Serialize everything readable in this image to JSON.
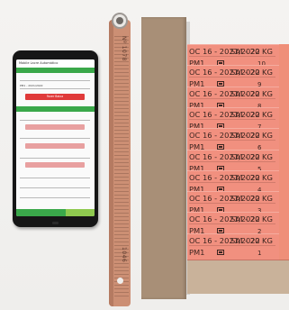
{
  "phone_screen": {
    "app_title": "Mobile Lacre Automático",
    "field_1_value": "PM1 - 2021/2022",
    "button_red": "Fazer Baixa"
  },
  "tags": [
    {
      "line1": "OC 16 - 2021/2022",
      "weight": "SAI - 20 KG",
      "code": "PM1",
      "number": "10"
    },
    {
      "line1": "OC 16 - 2021/2022",
      "weight": "SAI - 20 KG",
      "code": "PM1",
      "number": "9"
    },
    {
      "line1": "OC 16 - 2021/2022",
      "weight": "SAI - 20 KG",
      "code": "PM1",
      "number": "8"
    },
    {
      "line1": "OC 16 - 2021/2022",
      "weight": "SAI - 20 KG",
      "code": "PM1",
      "number": "7"
    },
    {
      "line1": "OC 16 - 2021/2022",
      "weight": "SAI - 20 KG",
      "code": "PM1",
      "number": "6"
    },
    {
      "line1": "OC 16 - 2021/2022",
      "weight": "SAI - 20 KG",
      "code": "PM1",
      "number": "5"
    },
    {
      "line1": "OC 16 - 2021/2022",
      "weight": "SAI - 20 KG",
      "code": "PM1",
      "number": "4"
    },
    {
      "line1": "OC 16 - 2021/2022",
      "weight": "SAI - 20 KG",
      "code": "PM1",
      "number": "3"
    },
    {
      "line1": "OC 16 - 2021/2022",
      "weight": "SAI - 20 KG",
      "code": "PM1",
      "number": "2"
    },
    {
      "line1": "OC 16 - 2021/2022",
      "weight": "SAI - 20 KG",
      "code": "PM1",
      "number": "1"
    }
  ],
  "strap": {
    "text_top": "Nº 1078",
    "text_bottom": "1046"
  }
}
